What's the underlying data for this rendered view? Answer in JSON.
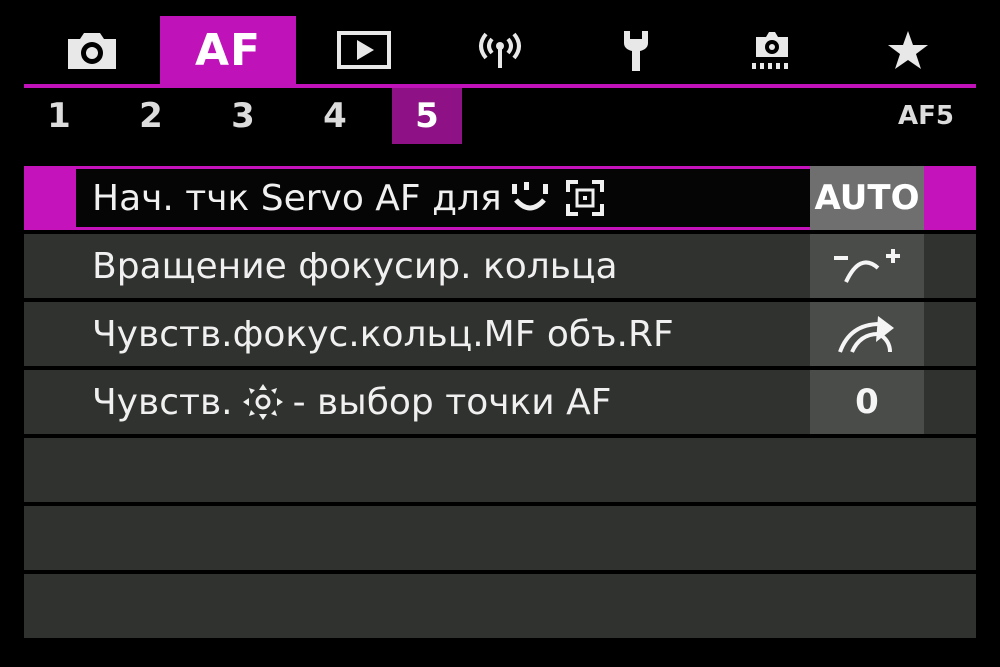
{
  "top_tabs": [
    {
      "id": "shooting",
      "icon": "camera-icon"
    },
    {
      "id": "af",
      "label": "AF",
      "active": true
    },
    {
      "id": "playback",
      "icon": "playback-icon"
    },
    {
      "id": "wireless",
      "icon": "wireless-icon"
    },
    {
      "id": "setup",
      "icon": "wrench-icon"
    },
    {
      "id": "custom",
      "icon": "custom-functions-icon"
    },
    {
      "id": "my_menu",
      "icon": "star-icon"
    }
  ],
  "sub_tabs": {
    "items": [
      "1",
      "2",
      "3",
      "4",
      "5"
    ],
    "active_index": 4,
    "page_id": "AF5"
  },
  "menu": {
    "items": [
      {
        "label_prefix": "Нач. тчк Servo AF для",
        "icons": [
          "face-tracking-icon",
          "af-frame-icon"
        ],
        "value": "AUTO",
        "selected": true
      },
      {
        "label": "Вращение фокусир. кольца",
        "value_icon": "ring-rotation-icon"
      },
      {
        "label": "Чувств.фокус.кольц.MF объ.RF",
        "value_icon": "ring-sensitivity-icon"
      },
      {
        "label_prefix": "Чувств.",
        "icons": [
          "smart-controller-icon"
        ],
        "label_suffix": "- выбор точки AF",
        "value": "0"
      }
    ]
  },
  "colors": {
    "accent": "#c012b9",
    "accent_dark": "#8e1186",
    "row_bg": "#2f322f",
    "value_bg": "#4a4c49"
  }
}
